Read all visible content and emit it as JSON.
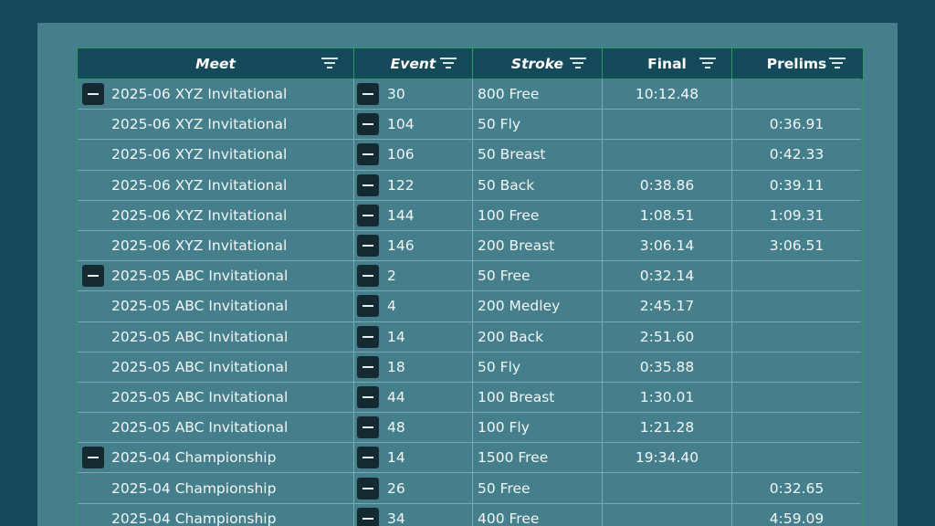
{
  "table": {
    "columns": [
      {
        "key": "meet",
        "label": "Meet",
        "italic": true
      },
      {
        "key": "event",
        "label": "Event",
        "italic": true
      },
      {
        "key": "stroke",
        "label": "Stroke",
        "italic": true
      },
      {
        "key": "final",
        "label": "Final",
        "italic": false
      },
      {
        "key": "prelims",
        "label": "Prelims",
        "italic": false
      }
    ],
    "rows": [
      {
        "meet": "2025-06 XYZ Invitational",
        "group_start": true,
        "event": "30",
        "stroke": "800 Free",
        "final": "10:12.48",
        "prelims": ""
      },
      {
        "meet": "2025-06 XYZ Invitational",
        "group_start": false,
        "event": "104",
        "stroke": "50 Fly",
        "final": "",
        "prelims": "0:36.91"
      },
      {
        "meet": "2025-06 XYZ Invitational",
        "group_start": false,
        "event": "106",
        "stroke": "50 Breast",
        "final": "",
        "prelims": "0:42.33"
      },
      {
        "meet": "2025-06 XYZ Invitational",
        "group_start": false,
        "event": "122",
        "stroke": "50 Back",
        "final": "0:38.86",
        "prelims": "0:39.11"
      },
      {
        "meet": "2025-06 XYZ Invitational",
        "group_start": false,
        "event": "144",
        "stroke": "100 Free",
        "final": "1:08.51",
        "prelims": "1:09.31"
      },
      {
        "meet": "2025-06 XYZ Invitational",
        "group_start": false,
        "event": "146",
        "stroke": "200 Breast",
        "final": "3:06.14",
        "prelims": "3:06.51"
      },
      {
        "meet": "2025-05 ABC Invitational",
        "group_start": true,
        "event": "2",
        "stroke": "50 Free",
        "final": "0:32.14",
        "prelims": ""
      },
      {
        "meet": "2025-05 ABC Invitational",
        "group_start": false,
        "event": "4",
        "stroke": "200 Medley",
        "final": "2:45.17",
        "prelims": ""
      },
      {
        "meet": "2025-05 ABC Invitational",
        "group_start": false,
        "event": "14",
        "stroke": "200 Back",
        "final": "2:51.60",
        "prelims": ""
      },
      {
        "meet": "2025-05 ABC Invitational",
        "group_start": false,
        "event": "18",
        "stroke": "50 Fly",
        "final": "0:35.88",
        "prelims": ""
      },
      {
        "meet": "2025-05 ABC Invitational",
        "group_start": false,
        "event": "44",
        "stroke": "100 Breast",
        "final": "1:30.01",
        "prelims": ""
      },
      {
        "meet": "2025-05 ABC Invitational",
        "group_start": false,
        "event": "48",
        "stroke": "100 Fly",
        "final": "1:21.28",
        "prelims": ""
      },
      {
        "meet": "2025-04 Championship",
        "group_start": true,
        "event": "14",
        "stroke": "1500 Free",
        "final": "19:34.40",
        "prelims": ""
      },
      {
        "meet": "2025-04 Championship",
        "group_start": false,
        "event": "26",
        "stroke": "50 Free",
        "final": "",
        "prelims": "0:32.65"
      },
      {
        "meet": "2025-04 Championship",
        "group_start": false,
        "event": "34",
        "stroke": "400 Free",
        "final": "",
        "prelims": "4:59.09"
      }
    ]
  },
  "icons": {
    "filter": "filter-icon",
    "collapse": "collapse-icon"
  },
  "colors": {
    "background": "#154a5a",
    "panel": "#467f8c",
    "header": "#154a5a",
    "grid_border": "#2f9a62",
    "toggle": "#152a30"
  }
}
